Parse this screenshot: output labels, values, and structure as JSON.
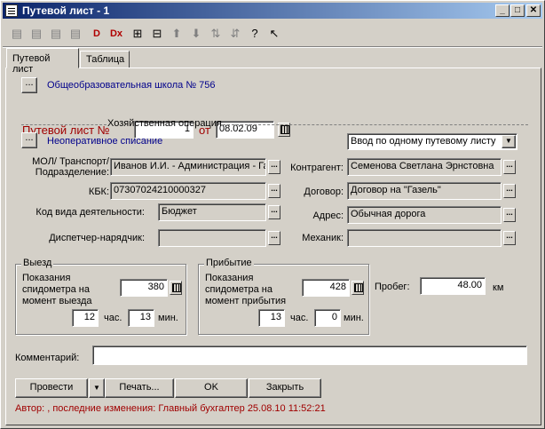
{
  "window": {
    "title": "Путевой лист - 1"
  },
  "titlebar_buttons": [
    "_",
    "□",
    "✕"
  ],
  "tabs": [
    {
      "label": "Путевой лист"
    },
    {
      "label": "Таблица"
    }
  ],
  "org": {
    "button": "...",
    "name": "Общеобразовательная школа № 756"
  },
  "waybill": {
    "label": "Путевой лист №",
    "number": "1",
    "from_label": "от",
    "date": "08.02.09"
  },
  "operation_section": "Хозяйственная операция",
  "operation": {
    "button": "...",
    "name": "Неоперативное списание",
    "mode": "Ввод по одному путевому листу"
  },
  "fields": {
    "mol_label": "МОЛ/ Транспорт/ Подразделение:",
    "mol_value": "Иванов И.И. - Администрация - Га",
    "counterparty_label": "Контрагент:",
    "counterparty_value": "Семенова Светлана Эрнстовна",
    "kbk_label": "КБК:",
    "kbk_value": "07307024210000327",
    "contract_label": "Договор:",
    "contract_value": "Договор на \"Газель\"",
    "activity_label": "Код вида деятельности:",
    "activity_value": "Бюджет",
    "address_label": "Адрес:",
    "address_value": "Обычная дорога",
    "dispatcher_label": "Диспетчер-нарядчик:",
    "dispatcher_value": "",
    "mechanic_label": "Механик:",
    "mechanic_value": ""
  },
  "departure": {
    "title": "Выезд",
    "speedo_label": "Показания спидометра на момент выезда",
    "speedo_value": "380",
    "hours": "12",
    "hours_label": "час.",
    "minutes": "13",
    "minutes_label": "мин."
  },
  "arrival": {
    "title": "Прибытие",
    "speedo_label": "Показания спидометра на момент прибытия",
    "speedo_value": "428",
    "hours": "13",
    "hours_label": "час.",
    "minutes": "0",
    "minutes_label": "мин."
  },
  "mileage": {
    "label": "Пробег:",
    "value": "48.00",
    "unit": "км"
  },
  "comment": {
    "label": "Комментарий:",
    "value": ""
  },
  "buttons": {
    "post": "Провести",
    "print": "Печать...",
    "ok": "OK",
    "close": "Закрыть"
  },
  "status": "Автор: , последние изменения: Главный бухгалтер 25.08.10 11:52:21",
  "colors": {
    "title_start": "#0a246a",
    "title_end": "#a6caf0",
    "link_blue": "#00008b",
    "status_red": "#a00000"
  }
}
